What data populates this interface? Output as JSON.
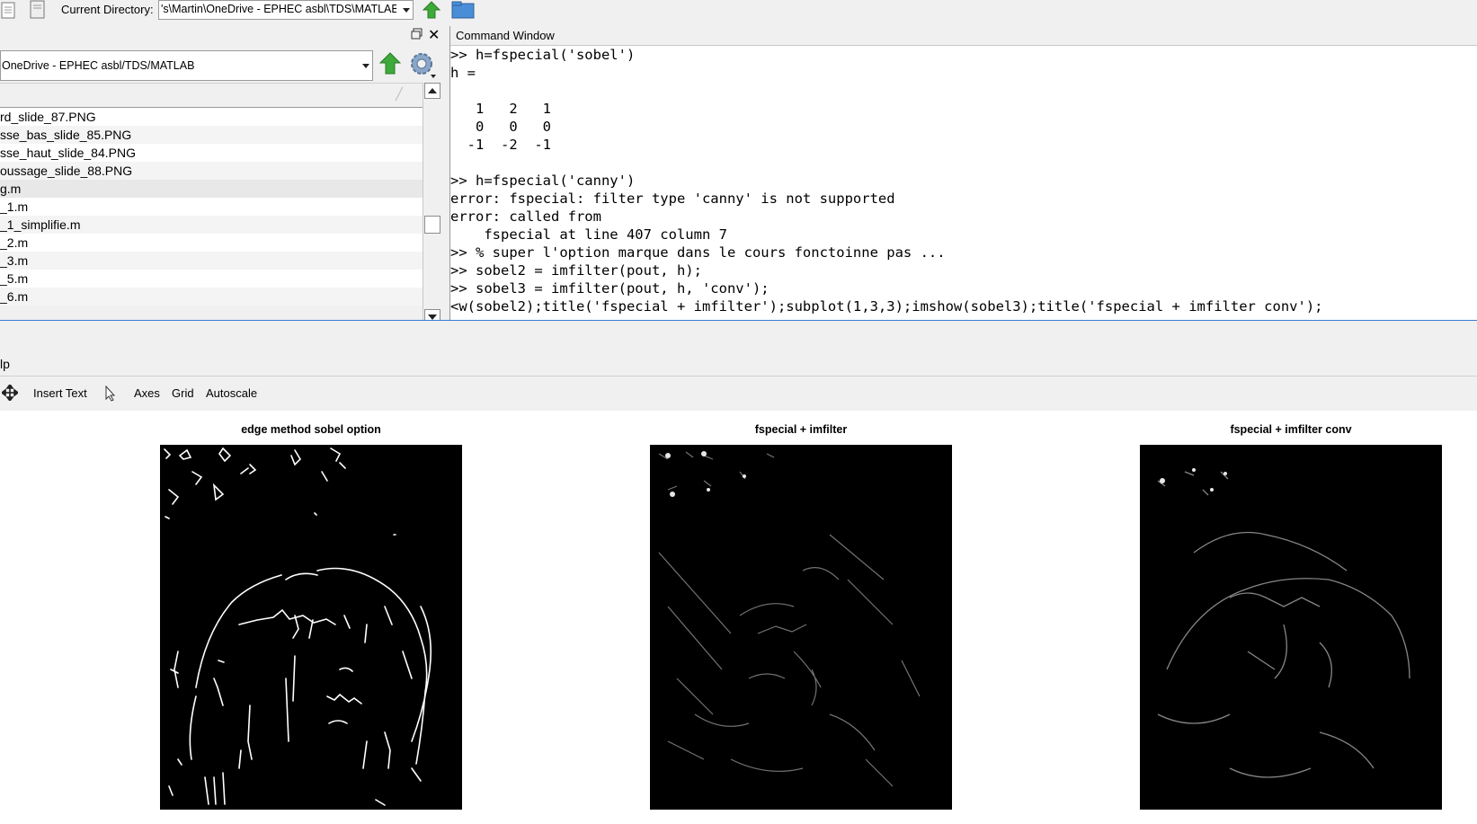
{
  "toolbar": {
    "current_directory_label": "Current Directory:",
    "current_directory_value": "'s\\Martin\\OneDrive - EPHEC asbl\\TDS\\MATLAB"
  },
  "file_browser": {
    "path": "OneDrive - EPHEC asbl/TDS/MATLAB",
    "files": [
      "rd_slide_87.PNG",
      "sse_bas_slide_85.PNG",
      "sse_haut_slide_84.PNG",
      "oussage_slide_88.PNG",
      "g.m",
      "_1.m",
      "_1_simplifie.m",
      "_2.m",
      "_3.m",
      "_5.m",
      "_6.m"
    ]
  },
  "command_window": {
    "title": "Command Window",
    "lines": [
      ">> h=fspecial('sobel')",
      "h =",
      "",
      "   1   2   1",
      "   0   0   0",
      "  -1  -2  -1",
      "",
      ">> h=fspecial('canny')",
      "error: fspecial: filter type 'canny' is not supported",
      "error: called from",
      "    fspecial at line 407 column 7",
      ">> % super l'option marque dans le cours fonctoinne pas ...",
      ">> sobel2 = imfilter(pout, h);",
      ">> sobel3 = imfilter(pout, h, 'conv');",
      "<w(sobel2);title('fspecial + imfilter');subplot(1,3,3);imshow(sobel3);title('fspecial + imfilter conv');"
    ]
  },
  "figure": {
    "menu_fragment": "lp",
    "tools": {
      "insert_text": "Insert Text",
      "axes": "Axes",
      "grid": "Grid",
      "autoscale": "Autoscale"
    },
    "subplots": [
      {
        "title": "edge method sobel option"
      },
      {
        "title": "fspecial + imfilter"
      },
      {
        "title": "fspecial + imfilter conv"
      }
    ]
  }
}
